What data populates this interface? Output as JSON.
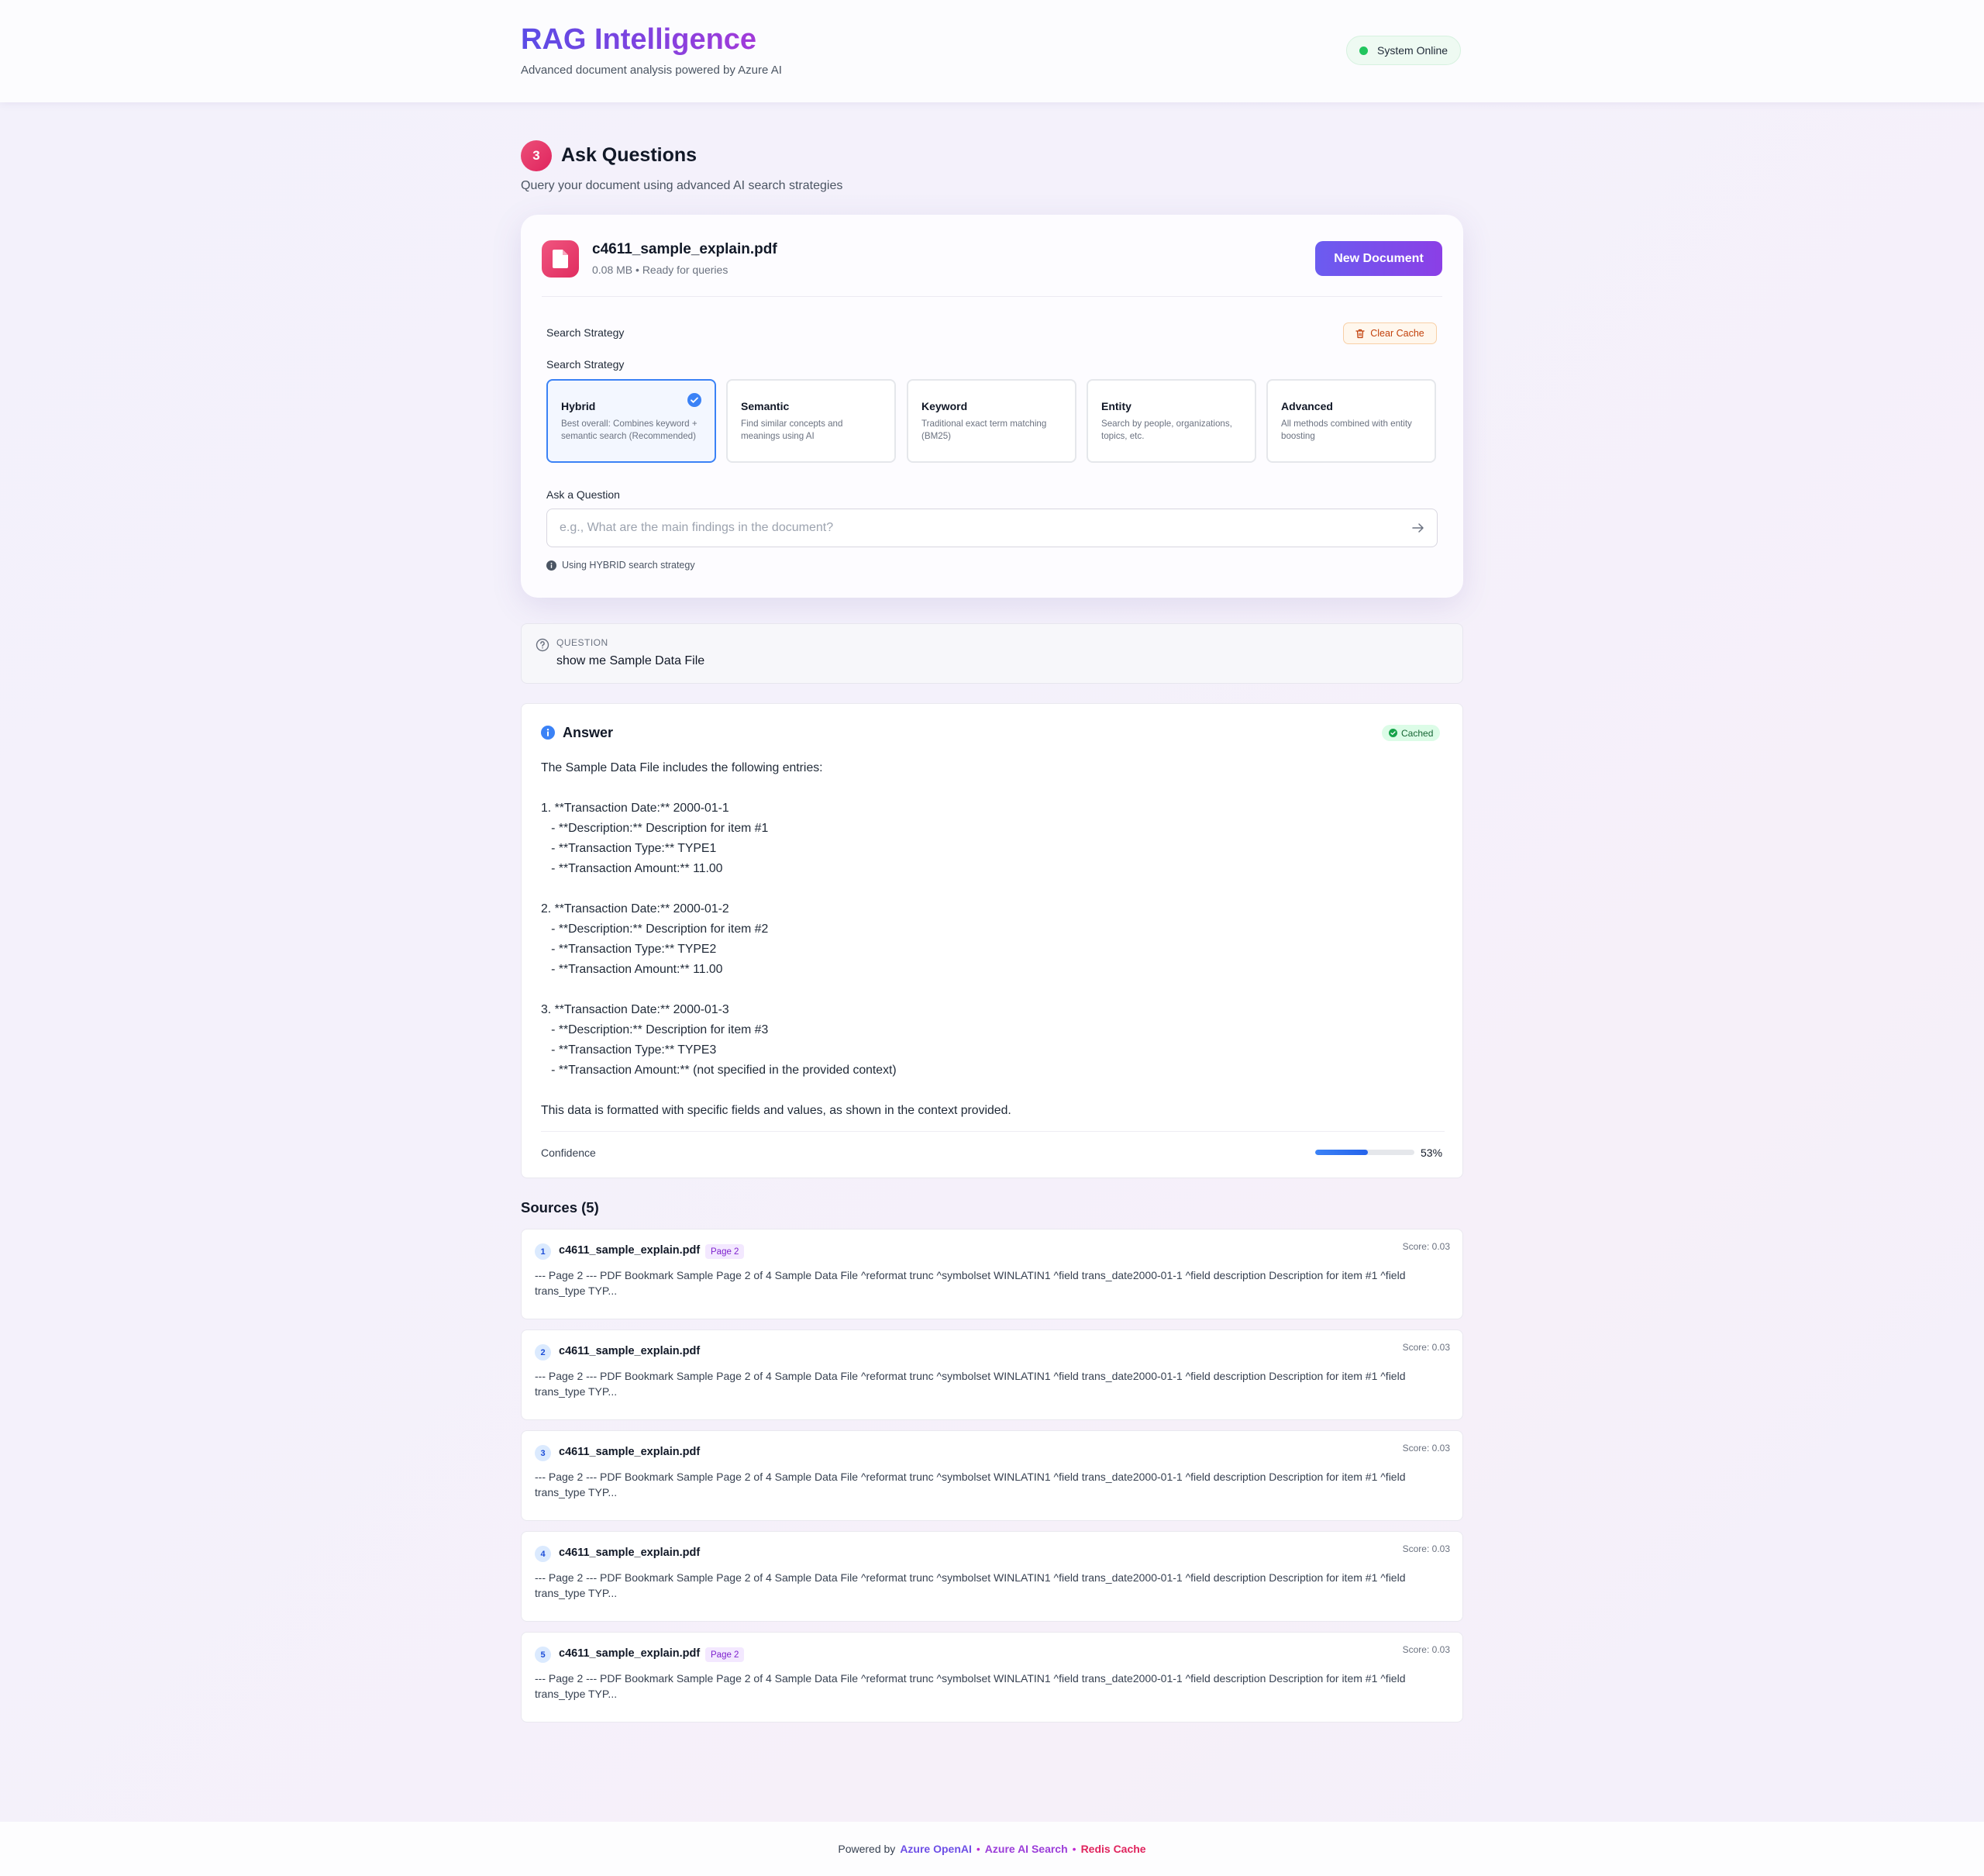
{
  "header": {
    "title": "RAG Intelligence",
    "subtitle": "Advanced document analysis powered by Azure AI",
    "status": "System Online"
  },
  "section": {
    "step": "3",
    "title": "Ask Questions",
    "subtitle": "Query your document using advanced AI search strategies"
  },
  "document": {
    "name": "c4611_sample_explain.pdf",
    "meta": "0.08 MB • Ready for queries",
    "new_button": "New Document"
  },
  "search": {
    "heading": "Search Strategy",
    "clear_cache": "Clear Cache",
    "label": "Search Strategy",
    "options": [
      {
        "name": "Hybrid",
        "desc": "Best overall: Combines keyword + semantic search (Recommended)",
        "selected": true
      },
      {
        "name": "Semantic",
        "desc": "Find similar concepts and meanings using AI",
        "selected": false
      },
      {
        "name": "Keyword",
        "desc": "Traditional exact term matching (BM25)",
        "selected": false
      },
      {
        "name": "Entity",
        "desc": "Search by people, organizations, topics, etc.",
        "selected": false
      },
      {
        "name": "Advanced",
        "desc": "All methods combined with entity boosting",
        "selected": false
      }
    ],
    "ask_label": "Ask a Question",
    "placeholder": "e.g., What are the main findings in the document?",
    "hint": "Using HYBRID search strategy"
  },
  "question": {
    "label": "QUESTION",
    "text": "show me Sample Data File"
  },
  "answer": {
    "title": "Answer",
    "badge": "Cached",
    "body": "The Sample Data File includes the following entries:\n\n1. **Transaction Date:** 2000-01-1\n   - **Description:** Description for item #1\n   - **Transaction Type:** TYPE1\n   - **Transaction Amount:** 11.00\n\n2. **Transaction Date:** 2000-01-2\n   - **Description:** Description for item #2\n   - **Transaction Type:** TYPE2\n   - **Transaction Amount:** 11.00\n\n3. **Transaction Date:** 2000-01-3\n   - **Description:** Description for item #3\n   - **Transaction Type:** TYPE3\n   - **Transaction Amount:** (not specified in the provided context)\n\nThis data is formatted with specific fields and values, as shown in the context provided.",
    "confidence_label": "Confidence",
    "confidence_value": "53%",
    "confidence_fraction": 0.53
  },
  "sources": {
    "title": "Sources (5)",
    "items": [
      {
        "num": "1",
        "file": "c4611_sample_explain.pdf",
        "page": "Page 2",
        "score": "Score: 0.03",
        "excerpt": "--- Page 2 --- PDF Bookmark Sample Page 2 of 4 Sample Data File ^reformat trunc ^symbolset WINLATIN1 ^field trans_date2000-01-1 ^field description Description for item #1 ^field trans_type TYP..."
      },
      {
        "num": "2",
        "file": "c4611_sample_explain.pdf",
        "page": "",
        "score": "Score: 0.03",
        "excerpt": "--- Page 2 --- PDF Bookmark Sample Page 2 of 4 Sample Data File ^reformat trunc ^symbolset WINLATIN1 ^field trans_date2000-01-1 ^field description Description for item #1 ^field trans_type TYP..."
      },
      {
        "num": "3",
        "file": "c4611_sample_explain.pdf",
        "page": "",
        "score": "Score: 0.03",
        "excerpt": "--- Page 2 --- PDF Bookmark Sample Page 2 of 4 Sample Data File ^reformat trunc ^symbolset WINLATIN1 ^field trans_date2000-01-1 ^field description Description for item #1 ^field trans_type TYP..."
      },
      {
        "num": "4",
        "file": "c4611_sample_explain.pdf",
        "page": "",
        "score": "Score: 0.03",
        "excerpt": "--- Page 2 --- PDF Bookmark Sample Page 2 of 4 Sample Data File ^reformat trunc ^symbolset WINLATIN1 ^field trans_date2000-01-1 ^field description Description for item #1 ^field trans_type TYP..."
      },
      {
        "num": "5",
        "file": "c4611_sample_explain.pdf",
        "page": "Page 2",
        "score": "Score: 0.03",
        "excerpt": "--- Page 2 --- PDF Bookmark Sample Page 2 of 4 Sample Data File ^reformat trunc ^symbolset WINLATIN1 ^field trans_date2000-01-1 ^field description Description for item #1 ^field trans_type TYP..."
      }
    ]
  },
  "footer": {
    "prefix": "Powered by",
    "openai": "Azure OpenAI",
    "sep": "•",
    "search": "Azure AI Search",
    "redis": "Redis Cache"
  },
  "icons": {
    "file": "file-icon",
    "check": "check-circle-icon",
    "trash": "trash-icon",
    "send": "arrow-right-icon",
    "info": "info-icon",
    "question": "question-circle-icon"
  },
  "colors": {
    "brand_start": "#5b4ce6",
    "brand_end": "#a23ad9",
    "accent_pink": "#e0245e",
    "selected_blue": "#3b82f6",
    "online_green": "#22c55e"
  }
}
